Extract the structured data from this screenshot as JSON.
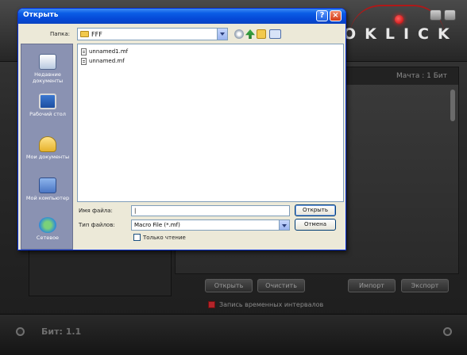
{
  "app": {
    "brand": "OKLICK",
    "panel_label": "Мачта : 1 Бит",
    "buttons": {
      "open": "Открыть",
      "clear": "Очистить",
      "import": "Импорт",
      "export": "Экспорт"
    },
    "checkbox_label": "Запись временных интервалов",
    "checkbox_checked": true,
    "status": "Бит: 1.1"
  },
  "dialog": {
    "title": "Открыть",
    "look_in_label": "Папка:",
    "look_in_value": "FFF",
    "places": [
      {
        "label": "Недавние документы",
        "icon": "recent-documents-icon"
      },
      {
        "label": "Рабочий стол",
        "icon": "desktop-icon"
      },
      {
        "label": "Мои документы",
        "icon": "my-documents-icon"
      },
      {
        "label": "Мой компьютер",
        "icon": "my-computer-icon"
      },
      {
        "label": "Сетевое",
        "icon": "network-icon"
      }
    ],
    "files": [
      "unnamed1.mf",
      "unnamed.mf"
    ],
    "file_name_label": "Имя файла:",
    "file_name_value": "",
    "file_type_label": "Тип файлов:",
    "file_type_value": "Macro File (*.mf)",
    "readonly_label": "Только чтение",
    "open_button": "Открыть",
    "cancel_button": "Отмена"
  }
}
